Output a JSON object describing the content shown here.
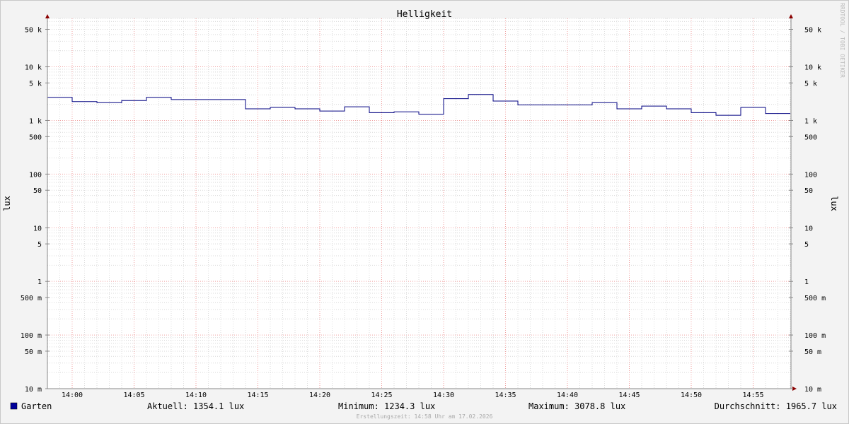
{
  "chart_data": {
    "type": "line",
    "title": "Helligkeit",
    "ylabel": "lux",
    "y_scale": "log",
    "ylim": [
      0.01,
      80000
    ],
    "y_ticks": [
      {
        "v": 50000,
        "label": "50 k"
      },
      {
        "v": 10000,
        "label": "10 k"
      },
      {
        "v": 5000,
        "label": "5 k"
      },
      {
        "v": 1000,
        "label": "1 k"
      },
      {
        "v": 500,
        "label": "500"
      },
      {
        "v": 100,
        "label": "100"
      },
      {
        "v": 50,
        "label": "50"
      },
      {
        "v": 10,
        "label": "10"
      },
      {
        "v": 5,
        "label": "5"
      },
      {
        "v": 1,
        "label": "1"
      },
      {
        "v": 0.5,
        "label": "500 m"
      },
      {
        "v": 0.1,
        "label": "100 m"
      },
      {
        "v": 0.05,
        "label": "50 m"
      },
      {
        "v": 0.01,
        "label": "10 m"
      }
    ],
    "x_ticks": [
      "14:00",
      "14:05",
      "14:10",
      "14:15",
      "14:20",
      "14:25",
      "14:30",
      "14:35",
      "14:40",
      "14:45",
      "14:50",
      "14:55"
    ],
    "xlim": [
      "13:58",
      "15:58"
    ],
    "grid": true,
    "series": [
      {
        "name": "Garten",
        "color": "#000080",
        "x": [
          "13:58",
          "14:00",
          "14:02",
          "14:04",
          "14:06",
          "14:08",
          "14:10",
          "14:12",
          "14:14",
          "14:16",
          "14:18",
          "14:20",
          "14:22",
          "14:24",
          "14:26",
          "14:28",
          "14:30",
          "14:32",
          "14:34",
          "14:36",
          "14:38",
          "14:40",
          "14:42",
          "14:44",
          "14:46",
          "14:48",
          "14:50",
          "14:52",
          "14:54",
          "14:56",
          "14:58"
        ],
        "values": [
          2700,
          2250,
          2150,
          2350,
          2700,
          2450,
          2450,
          2450,
          1650,
          1750,
          1650,
          1500,
          1800,
          1400,
          1450,
          1300,
          2550,
          3050,
          2300,
          1950,
          1950,
          1950,
          2150,
          1650,
          1850,
          1650,
          1400,
          1250,
          1750,
          1350,
          1350
        ]
      }
    ]
  },
  "legend": {
    "series_label": "Garten",
    "series_color": "#000099",
    "current": "Aktuell: 1354.1 lux",
    "minimum": "Minimum: 1234.3 lux",
    "maximum": "Maximum: 3078.8 lux",
    "average": "Durchschnitt: 1965.7 lux"
  },
  "footer": "Erstellungszeit: 14:58 Uhr am 17.02.2026",
  "watermark": "RRDTOOL / TOBI OETIKER"
}
